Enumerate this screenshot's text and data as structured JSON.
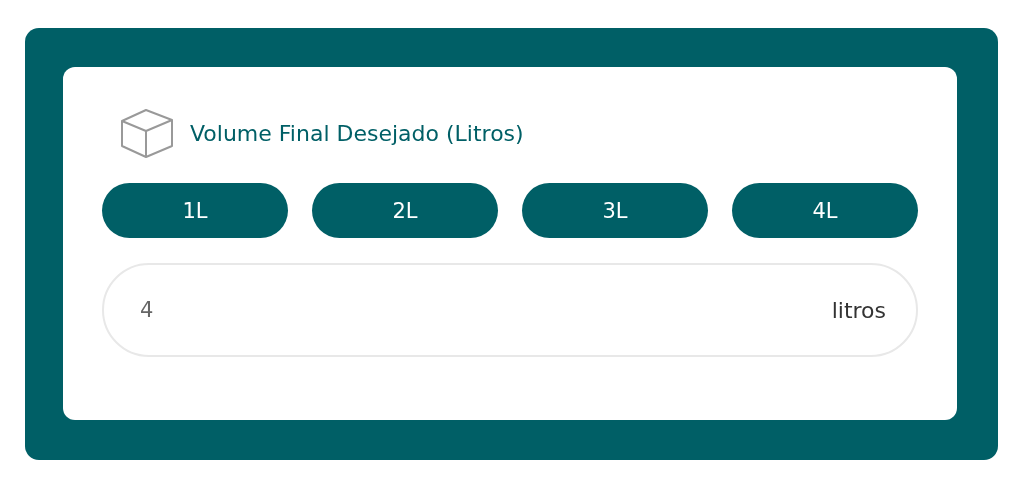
{
  "title": "Volume Final Desejado (Litros)",
  "presets": [
    {
      "label": "1L"
    },
    {
      "label": "2L"
    },
    {
      "label": "3L"
    },
    {
      "label": "4L"
    }
  ],
  "volume_field": {
    "value": "4",
    "unit": "litros"
  }
}
